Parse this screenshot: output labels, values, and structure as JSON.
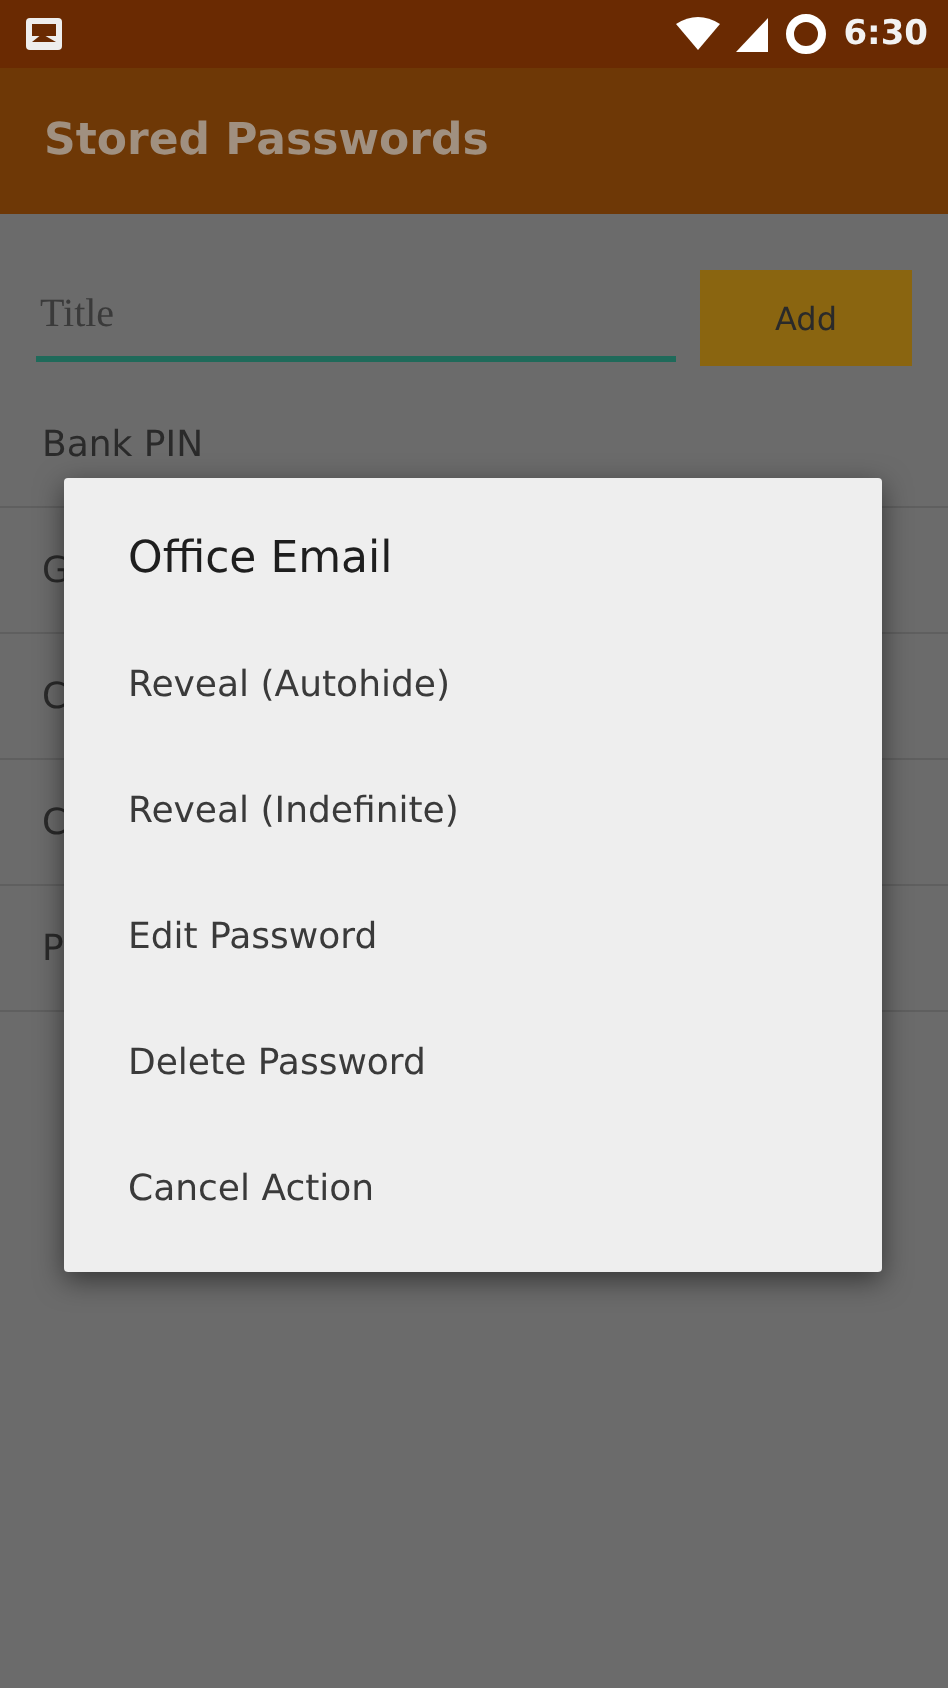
{
  "status_bar": {
    "time": "6:30"
  },
  "app_bar": {
    "title": "Stored Passwords"
  },
  "add_form": {
    "placeholder": "Title",
    "button": "Add"
  },
  "passwords": [
    {
      "title": "Bank PIN"
    },
    {
      "title": "G"
    },
    {
      "title": "C"
    },
    {
      "title": "C"
    },
    {
      "title": "P"
    }
  ],
  "dialog": {
    "title": "Office Email",
    "actions": [
      "Reveal (Autohide)",
      "Reveal (Indefinite)",
      "Edit Password",
      "Delete Password",
      "Cancel Action"
    ]
  }
}
